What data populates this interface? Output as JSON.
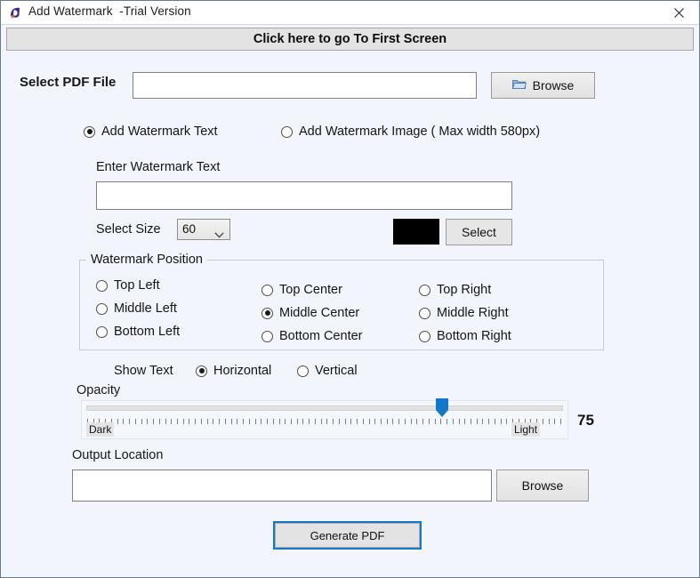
{
  "window": {
    "title": "Add Watermark  -Trial Version",
    "app_icon": "app-logo-icon",
    "close_icon": "close-icon",
    "background_color": "#f2f6fc"
  },
  "banner": {
    "label": "Click here to go To First Screen"
  },
  "select_pdf": {
    "label": "Select PDF File",
    "value": "",
    "placeholder": "",
    "browse_label": "Browse",
    "browse_icon": "folder-icon"
  },
  "watermark_type": {
    "options": [
      {
        "label": "Add Watermark Text",
        "selected": true
      },
      {
        "label": "Add Watermark Image ( Max width 580px)",
        "selected": false
      }
    ]
  },
  "watermark_text": {
    "label": "Enter Watermark Text",
    "value": "",
    "placeholder": ""
  },
  "size": {
    "label": "Select Size",
    "value": "60",
    "chevron_icon": "chevron-down-icon"
  },
  "color": {
    "swatch_color": "#000000",
    "select_label": "Select"
  },
  "position": {
    "legend": "Watermark Position",
    "left_column": [
      {
        "label": "Top Left",
        "selected": false
      },
      {
        "label": "Middle Left",
        "selected": false
      },
      {
        "label": "Bottom Left",
        "selected": false
      }
    ],
    "center_column": [
      {
        "label": "Top Center",
        "selected": false
      },
      {
        "label": "Middle Center",
        "selected": true
      },
      {
        "label": "Bottom Center",
        "selected": false
      }
    ],
    "right_column": [
      {
        "label": "Top Right",
        "selected": false
      },
      {
        "label": "Middle Right",
        "selected": false
      },
      {
        "label": "Bottom Right",
        "selected": false
      }
    ]
  },
  "orientation": {
    "label": "Show Text",
    "options": [
      {
        "label": "Horizontal",
        "selected": true
      },
      {
        "label": "Vertical",
        "selected": false
      }
    ]
  },
  "opacity": {
    "label": "Opacity",
    "dark_label": "Dark",
    "light_label": "Light",
    "value": "75",
    "thumb_color": "#1478c8"
  },
  "output_location": {
    "label": "Output Location",
    "value": "",
    "placeholder": "",
    "browse_label": "Browse"
  },
  "generate": {
    "label": "Generate PDF",
    "focus_color": "#1478c8"
  }
}
